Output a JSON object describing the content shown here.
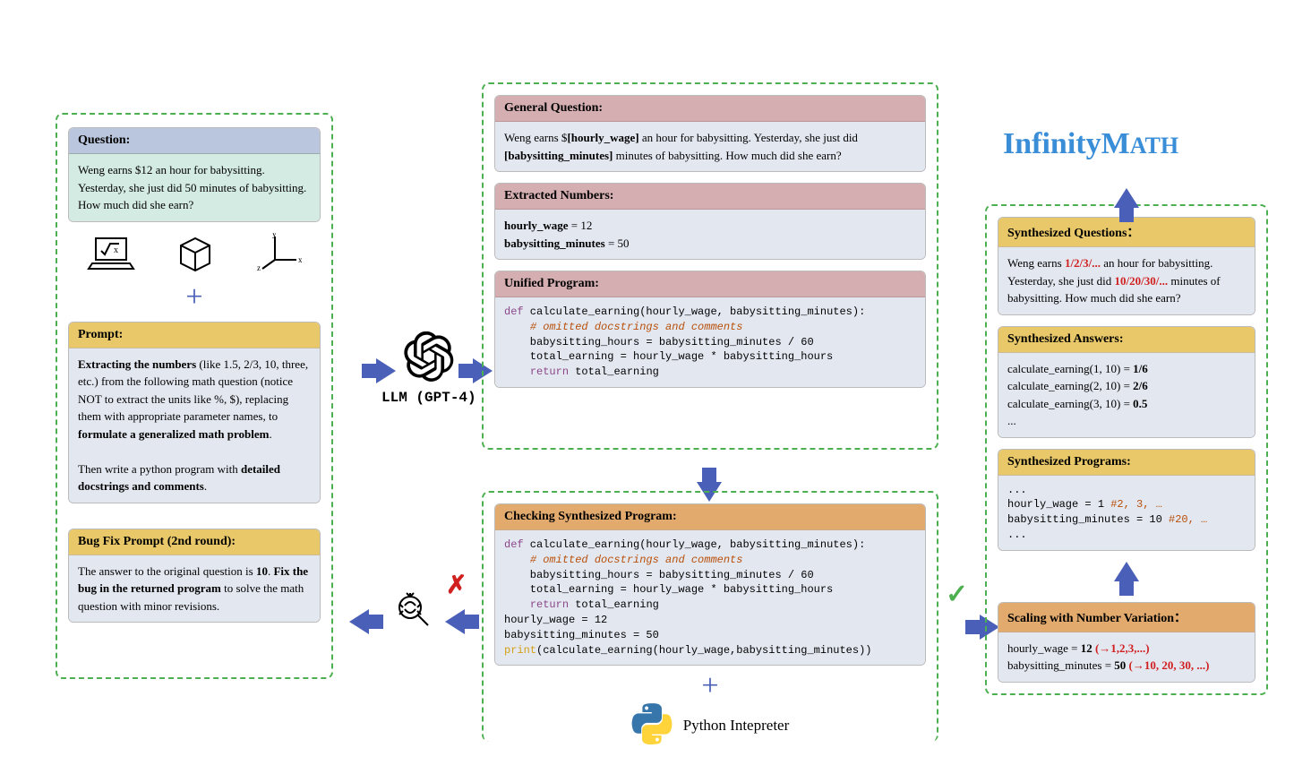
{
  "title_brand": "InfinityMATH",
  "left": {
    "question_header": "Question:",
    "question_body": "Weng earns $12 an hour for babysitting. Yesterday, she just did 50 minutes of babysitting. How much did she earn?",
    "prompt_header": "Prompt:",
    "prompt_body_html": "<b>Extracting the numbers</b> (like 1.5, 2/3, 10, three, etc.) from the following math question (notice NOT to extract the units like %, $), replacing them with appropriate parameter names, to <b>formulate a generalized math problem</b>.<br><br>Then write a python program with <b>detailed docstrings and comments</b>.",
    "bugfix_header": "Bug Fix Prompt (2nd round):",
    "bugfix_body_html": "The answer to the original question is <b>10</b>. <b>Fix the bug in the returned program</b> to solve the math question with minor revisions."
  },
  "llm_label": "LLM (GPT-4)",
  "mid": {
    "general_q_header": "General Question:",
    "general_q_body_html": "Weng earns $<b>[hourly_wage]</b> an hour for babysitting. Yesterday, she just did <b>[babysitting_minutes]</b> minutes of babysitting. How much did she earn?",
    "extracted_header": "Extracted Numbers:",
    "extracted_body_html": "<b>hourly_wage</b> = 12<br><b>babysitting_minutes</b> = 50",
    "unified_header": "Unified Program:",
    "unified_code": "def calculate_earning(hourly_wage, babysitting_minutes):\n    # omitted docstrings and comments\n    babysitting_hours = babysitting_minutes / 60\n    total_earning = hourly_wage * babysitting_hours\n    return total_earning",
    "checking_header": "Checking Synthesized Program:",
    "checking_code": "def calculate_earning(hourly_wage, babysitting_minutes):\n    # omitted docstrings and comments\n    babysitting_hours = babysitting_minutes / 60\n    total_earning = hourly_wage * babysitting_hours\n    return total_earning\nhourly_wage = 12\nbabysitting_minutes = 50\nprint(calculate_earning(hourly_wage,babysitting_minutes))",
    "python_label": "Python Intepreter"
  },
  "right": {
    "synth_q_header": "Synthesized Questions：",
    "synth_q_body_html": "Weng earns <span class='kw-red'>1/2/3/...</span> an hour for babysitting. Yesterday, she just did <span class='kw-red'>10/20/30/...</span> minutes of babysitting. How much did she earn?",
    "synth_a_header": "Synthesized Answers:",
    "synth_a_body_html": "calculate_earning(1, 10) = <b>1/6</b><br>calculate_earning(2, 10) = <b>2/6</b><br>calculate_earning(3, 10) = <b>0.5</b><br>...",
    "synth_p_header": "Synthesized Programs:",
    "synth_p_body_html": "...<br>hourly_wage = 1 <span style='color:#b8500a'>#2, 3, …</span><br>babysitting_minutes = 10 <span style='color:#b8500a'>#20, …</span><br>...",
    "scaling_header": "Scaling with Number Variation：",
    "scaling_body_html": "hourly_wage = <b>12</b> <span class='kw-red'>(→1,2,3,...)</span><br>babysitting_minutes = <b>50</b> <span class='kw-red'>(→10, 20, 30, ...)</span>"
  }
}
